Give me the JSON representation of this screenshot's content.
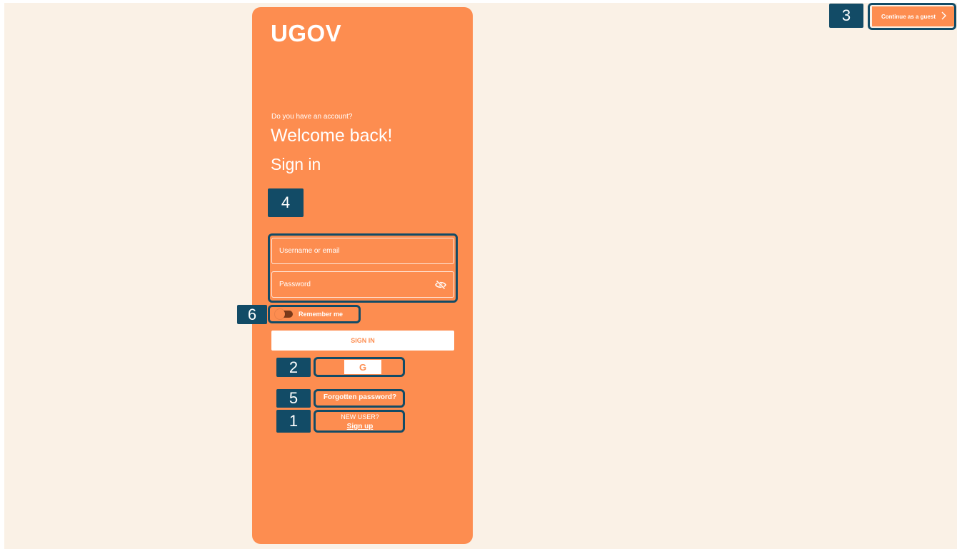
{
  "brand": "UGOV",
  "login": {
    "question": "Do you have an account?",
    "welcome": "Welcome back!",
    "title": "Sign in",
    "username_placeholder": "Username or email",
    "password_placeholder": "Password",
    "remember_label": "Remember me",
    "remember_enabled": false,
    "signin_label": "SIGN IN",
    "google_label": "G",
    "forgot_label": "Forgotten password?",
    "new_user_label": "NEW USER?",
    "signup_label": "Sign up"
  },
  "guest": {
    "label": "Continue as a guest"
  },
  "annotations": {
    "labels": [
      "1",
      "2",
      "3",
      "4",
      "5",
      "6"
    ],
    "color": "#124b66"
  },
  "colors": {
    "accent": "#fd8d50",
    "background": "#faf1e6",
    "annotation": "#124b66"
  },
  "icons": {
    "password_toggle": "eye-off-icon",
    "guest_arrow": "chevron-right-icon"
  }
}
